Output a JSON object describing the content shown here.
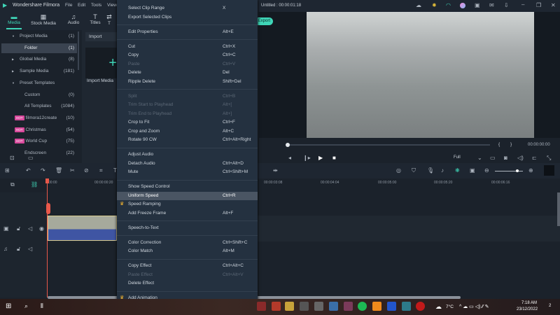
{
  "app": {
    "title": "Wondershare Filmora",
    "project_title": "Untitled : 00:00:01:18",
    "menu": [
      "File",
      "Edit",
      "Tools",
      "View"
    ]
  },
  "tabs": [
    {
      "label": "Media",
      "icon": "folder-icon",
      "active": true
    },
    {
      "label": "Stock Media",
      "icon": "stock-icon"
    },
    {
      "label": "Audio",
      "icon": "music-icon"
    },
    {
      "label": "Titles",
      "icon": "text-icon"
    },
    {
      "label": "T",
      "icon": "transition-icon"
    }
  ],
  "sidebar": {
    "items": [
      {
        "label": "Project Media",
        "count": "(1)",
        "arrow": "▼"
      },
      {
        "label": "Folder",
        "count": "(1)",
        "selected": true
      },
      {
        "label": "Global Media",
        "count": "(8)",
        "arrow": "▶"
      },
      {
        "label": "Sample Media",
        "count": "(181)",
        "arrow": "▶"
      },
      {
        "label": "Preset Templates",
        "count": "",
        "arrow": "▼"
      },
      {
        "label": "Custom",
        "count": "(0)"
      },
      {
        "label": "All Templates",
        "count": "(1084)"
      },
      {
        "label": "filmora12create",
        "count": "(10)",
        "hot": "HOT"
      },
      {
        "label": "Christmas",
        "count": "(54)",
        "hot": "HOT"
      },
      {
        "label": "World Cup",
        "count": "(75)",
        "hot": "HOT"
      },
      {
        "label": "Endscreen",
        "count": "(22)"
      }
    ]
  },
  "media": {
    "import_label": "Import",
    "import_media_label": "Import Media"
  },
  "export_label": "Export",
  "context_menu": [
    {
      "label": "Select Clip Range",
      "shortcut": "X"
    },
    {
      "label": "Export Selected Clips",
      "shortcut": ""
    },
    {
      "sep": true
    },
    {
      "label": "Edit Properties",
      "shortcut": "Alt+E"
    },
    {
      "sep": true
    },
    {
      "label": "Cut",
      "shortcut": "Ctrl+X"
    },
    {
      "label": "Copy",
      "shortcut": "Ctrl+C"
    },
    {
      "label": "Paste",
      "shortcut": "Ctrl+V",
      "disabled": true
    },
    {
      "label": "Delete",
      "shortcut": "Del"
    },
    {
      "label": "Ripple Delete",
      "shortcut": "Shift+Del"
    },
    {
      "sep": true
    },
    {
      "label": "Split",
      "shortcut": "Ctrl+B",
      "disabled": true
    },
    {
      "label": "Trim Start to Playhead",
      "shortcut": "Alt+[",
      "disabled": true
    },
    {
      "label": "Trim End to Playhead",
      "shortcut": "Alt+]",
      "disabled": true
    },
    {
      "label": "Crop to Fit",
      "shortcut": "Ctrl+F"
    },
    {
      "label": "Crop and Zoom",
      "shortcut": "Alt+C"
    },
    {
      "label": "Rotate 90 CW",
      "shortcut": "Ctrl+Alt+Right"
    },
    {
      "sep": true
    },
    {
      "label": "Adjust Audio",
      "shortcut": ""
    },
    {
      "label": "Detach Audio",
      "shortcut": "Ctrl+Alt+D"
    },
    {
      "label": "Mute",
      "shortcut": "Ctrl+Shift+M"
    },
    {
      "sep": true
    },
    {
      "label": "Show Speed Control",
      "shortcut": ""
    },
    {
      "label": "Uniform Speed",
      "shortcut": "Ctrl+R",
      "highlighted": true
    },
    {
      "label": "Speed Ramping",
      "shortcut": "",
      "crown": true
    },
    {
      "label": "Add Freeze Frame",
      "shortcut": "Alt+F"
    },
    {
      "sep": true
    },
    {
      "label": "Speech-to-Text",
      "shortcut": ""
    },
    {
      "sep": true
    },
    {
      "label": "Color Correction",
      "shortcut": "Ctrl+Shift+C"
    },
    {
      "label": "Color Match",
      "shortcut": "Alt+M"
    },
    {
      "sep": true
    },
    {
      "label": "Copy Effect",
      "shortcut": "Ctrl+Alt+C"
    },
    {
      "label": "Paste Effect",
      "shortcut": "Ctrl+Alt+V",
      "disabled": true
    },
    {
      "label": "Delete Effect",
      "shortcut": ""
    },
    {
      "sep": true
    },
    {
      "label": "Add Animation",
      "shortcut": "",
      "crown": true
    }
  ],
  "player": {
    "timecode": "00:00:00:00",
    "quality": "Full",
    "mark_in": "{",
    "mark_out": "}"
  },
  "timeline": {
    "ruler": [
      "00:00",
      "00:00:00:20",
      "00:00:03:08",
      "00:00:04:04",
      "00:00:05:00",
      "00:00:05:20",
      "00:00:06:16"
    ]
  },
  "taskbar": {
    "time": "7:18 AM",
    "date": "23/12/2022",
    "weather": "7°C",
    "notifications": "2"
  },
  "colors": {
    "accent": "#3fd6b8",
    "playhead": "#e8584a",
    "menu_bg": "#243140"
  }
}
